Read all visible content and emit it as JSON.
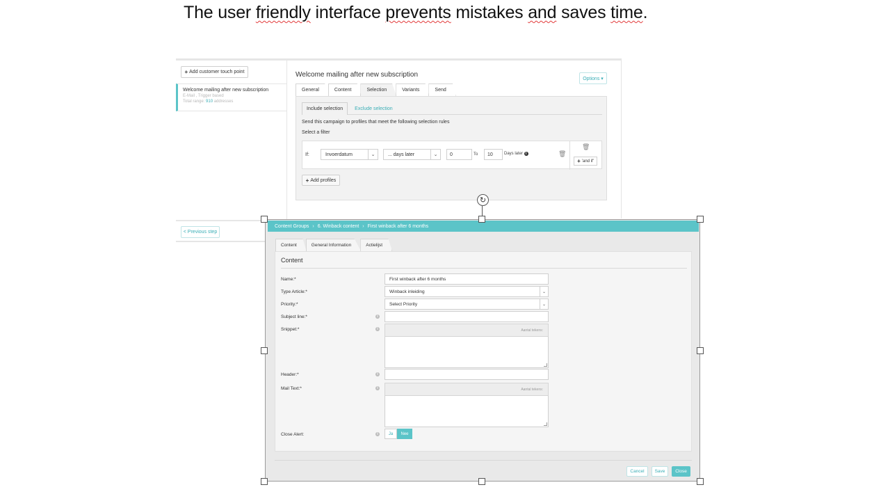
{
  "slide": {
    "title_words": [
      "The user ",
      "friendly",
      " interface ",
      "prevents",
      " mistakes ",
      "and",
      " saves ",
      "time",
      "."
    ]
  },
  "campaign": {
    "add_touch_point": "Add customer touch point",
    "touch_point": {
      "title": "Welcome mailing after new subscription",
      "type": "E-Mail , Trigger based",
      "range_prefix": "Total range:",
      "range_count": "910",
      "range_suffix": "addresses"
    },
    "main_title": "Welcome mailing after new subscription",
    "options_label": "Options ▾",
    "tabs": [
      "General",
      "Content",
      "Selection",
      "Variants",
      "Send"
    ],
    "subtabs": {
      "include": "Include selection",
      "exclude": "Exclude selection"
    },
    "rule_text": "Send this campaign to profiles that meet the following selection rules",
    "select_filter": "Select a filter",
    "filter": {
      "if_label": "If:",
      "field": "Invoerdatum",
      "operator": "... days later",
      "from": "0",
      "to_label": "To",
      "to": "10",
      "unit": "Days later",
      "and_if": "'and if'"
    },
    "add_profiles": "Add profiles",
    "previous_step": "< Previous step"
  },
  "content_editor": {
    "breadcrumb": [
      "Content Groups",
      "6. Winback content",
      "First winback after 6 months"
    ],
    "tabs": [
      "Content",
      "General Information",
      "Actielijst"
    ],
    "section_title": "Content",
    "fields": {
      "name_label": "Name:*",
      "name_value": "First winback after 6 months",
      "type_label": "Type Article:*",
      "type_value": "Winback inleiding",
      "priority_label": "Priority:*",
      "priority_value": "Select Priority",
      "subject_label": "Subject line:*",
      "snippet_label": "Snippet:*",
      "token_count": "Aantal tekens:",
      "header_label": "Header:*",
      "mailtext_label": "Mail Text:*",
      "close_alert_label": "Close Alert:",
      "toggle_yes": "Ja",
      "toggle_no": "Nee"
    },
    "buttons": {
      "cancel": "Cancel",
      "save": "Save",
      "close": "Close"
    }
  },
  "colors": {
    "accent": "#5bc4c8",
    "accent_text": "#3aaeb6"
  }
}
